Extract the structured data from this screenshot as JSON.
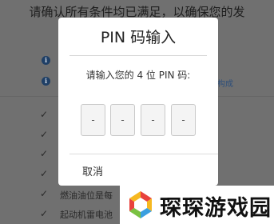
{
  "background": {
    "header_text": "请确认所有条件均已满足，以确保您的发",
    "info_right_text": "构成",
    "rows_bottom": [
      "燃油油位是每",
      "起动机雷电池"
    ]
  },
  "dialog": {
    "title": "PIN 码输入",
    "prompt": "请输入您的 4 位 PIN 码:",
    "pin_digits": [
      "-",
      "-",
      "-",
      "-"
    ],
    "cancel_label": "取消"
  },
  "watermark": {
    "text": "琛琛游戏园",
    "colors": [
      "#e8423c",
      "#f6b820",
      "#3a9fe0",
      "#7ac142"
    ]
  }
}
